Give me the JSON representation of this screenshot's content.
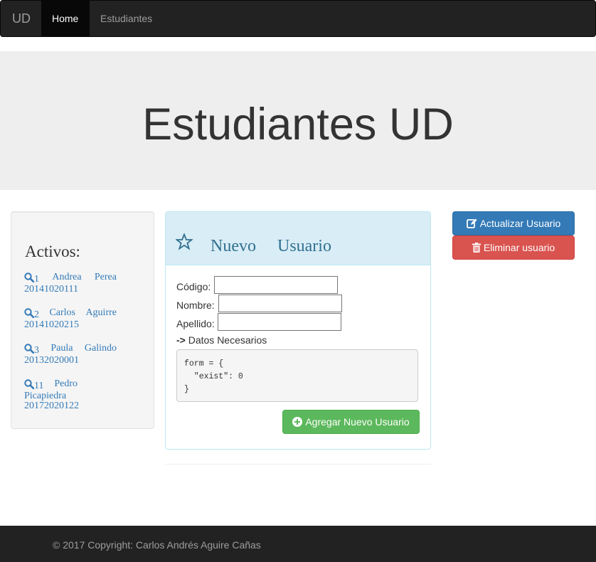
{
  "navbar": {
    "brand": "UD",
    "items": [
      {
        "label": "Home",
        "active": true
      },
      {
        "label": "Estudiantes",
        "active": false
      }
    ]
  },
  "jumbotron": {
    "title": "Estudiantes UD"
  },
  "sidebar": {
    "heading": "Activos:",
    "students": [
      {
        "id": "1",
        "first": "Andrea",
        "last": "Perea",
        "code": "20141020111"
      },
      {
        "id": "2",
        "first": "Carlos",
        "last": "Aguirre",
        "code": "20141020215"
      },
      {
        "id": "3",
        "first": "Paula",
        "last": "Galindo",
        "code": "20132020001"
      },
      {
        "id": "11",
        "first": "Pedro",
        "last": "Picapiedra",
        "code": "20172020122"
      }
    ]
  },
  "panel": {
    "title": "Nuevo Usuario",
    "fields": [
      {
        "label": "Código:",
        "value": ""
      },
      {
        "label": "Nombre:",
        "value": ""
      },
      {
        "label": "Apellido:",
        "value": ""
      }
    ],
    "hint_arrow": "->",
    "hint_text": "Datos Necesarios",
    "code": "form = {\n  \"exist\": 0\n}",
    "submit_label": "Agregar Nuevo Usuario"
  },
  "actions": {
    "update_label": "Actualizar Usuario",
    "delete_label": "Eliminar usuario"
  },
  "footer": {
    "text": "© 2017 Copyright: Carlos Andrés Aguire Cañas"
  },
  "colors": {
    "navbar": "#222222",
    "primary": "#337ab7",
    "success": "#5cb85c",
    "danger": "#d9534f",
    "info_bg": "#d9edf7",
    "info_text": "#31708f"
  },
  "icons": {
    "student": "search-icon",
    "panel": "star-empty-icon",
    "submit": "plus-sign-icon",
    "update": "edit-icon",
    "delete": "trash-icon"
  }
}
